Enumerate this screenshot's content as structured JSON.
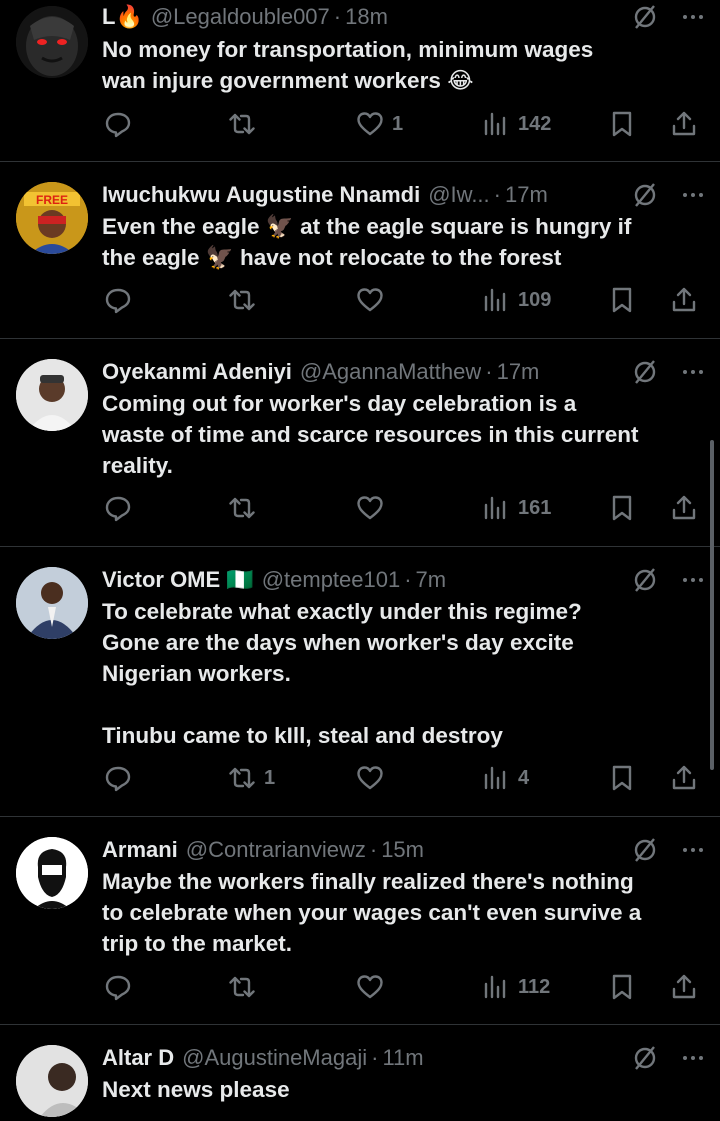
{
  "colors": {
    "background": "#000000",
    "text": "#e7e9ea",
    "muted": "#71767b",
    "divider": "#2f3336"
  },
  "tweets": [
    {
      "name": "L🔥",
      "handle": "@Legaldouble007",
      "time": "18m",
      "lines": [
        "No money for transportation, minimum wages",
        "wan injure government workers 😂"
      ],
      "replies": "",
      "retweets": "",
      "likes": "1",
      "views": "142"
    },
    {
      "name": "Iwuchukwu Augustine Nnamdi",
      "handle": "@Iw...",
      "time": "17m",
      "lines": [
        "Even the eagle 🦅 at the eagle square is hungry if",
        "the eagle 🦅 have not relocate to the forest"
      ],
      "replies": "",
      "retweets": "",
      "likes": "",
      "views": "109",
      "avatar_text": "FREE"
    },
    {
      "name": "Oyekanmi Adeniyi",
      "handle": "@AgannaMatthew",
      "time": "17m",
      "lines": [
        "Coming out for worker's day celebration is a",
        "waste of time and scarce resources in this current",
        "reality."
      ],
      "replies": "",
      "retweets": "",
      "likes": "",
      "views": "161"
    },
    {
      "name": "Victor OME 🇳🇬",
      "handle": "@temptee101",
      "time": "7m",
      "lines": [
        "To celebrate what exactly under this regime?",
        "Gone are the days when worker's day excite",
        "Nigerian workers.",
        "",
        "Tinubu came to kIll, steal and destroy"
      ],
      "replies": "",
      "retweets": "1",
      "likes": "",
      "views": "4"
    },
    {
      "name": "Armani",
      "handle": "@Contrarianviewz",
      "time": "15m",
      "lines": [
        "Maybe the workers finally realized there's nothing",
        "to celebrate when your wages can't even survive a",
        "trip to the market."
      ],
      "replies": "",
      "retweets": "",
      "likes": "",
      "views": "112"
    },
    {
      "name": "Altar D",
      "handle": "@AugustineMagaji",
      "time": "11m",
      "lines": [
        "Next news please"
      ],
      "replies": "",
      "retweets": "",
      "likes": "",
      "views": ""
    }
  ],
  "icons": {
    "reply": "reply-icon",
    "retweet": "retweet-icon",
    "like": "heart-icon",
    "views": "views-icon",
    "bookmark": "bookmark-icon",
    "share": "share-icon",
    "grok": "grok-icon",
    "more": "more-icon"
  }
}
